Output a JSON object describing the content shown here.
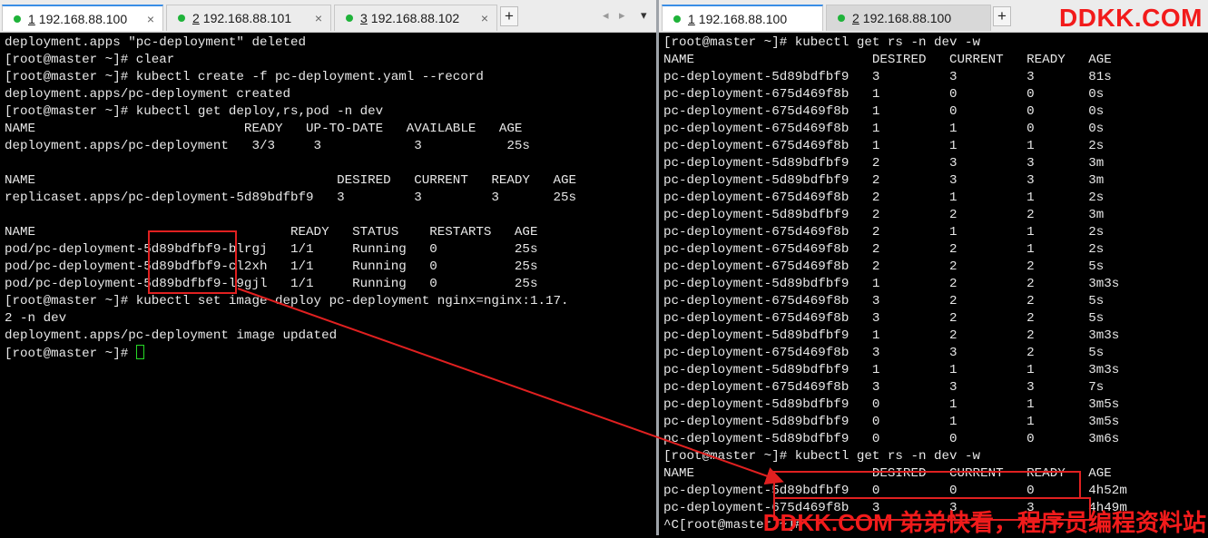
{
  "left_tabs": [
    {
      "num": "1",
      "host": "192.168.88.100"
    },
    {
      "num": "2",
      "host": "192.168.88.101"
    },
    {
      "num": "3",
      "host": "192.168.88.102"
    }
  ],
  "right_tabs": [
    {
      "num": "1",
      "host": "192.168.88.100"
    },
    {
      "num": "2",
      "host": "192.168.88.100"
    }
  ],
  "tab_close_glyph": "×",
  "add_tab_glyph": "+",
  "nav_prev_glyph": "◂",
  "nav_next_glyph": "▸",
  "tab_menu_glyph": "▾",
  "status_dot_color": "#1fb33a",
  "left_terminal": [
    "deployment.apps \"pc-deployment\" deleted",
    "[root@master ~]# clear",
    "[root@master ~]# kubectl create -f pc-deployment.yaml --record",
    "deployment.apps/pc-deployment created",
    "[root@master ~]# kubectl get deploy,rs,pod -n dev",
    "NAME                           READY   UP-TO-DATE   AVAILABLE   AGE",
    "deployment.apps/pc-deployment   3/3     3            3           25s",
    "",
    "NAME                                       DESIRED   CURRENT   READY   AGE",
    "replicaset.apps/pc-deployment-5d89bdfbf9   3         3         3       25s",
    "",
    "NAME                                 READY   STATUS    RESTARTS   AGE",
    "pod/pc-deployment-5d89bdfbf9-blrgj   1/1     Running   0          25s",
    "pod/pc-deployment-5d89bdfbf9-cl2xh   1/1     Running   0          25s",
    "pod/pc-deployment-5d89bdfbf9-l9gjl   1/1     Running   0          25s",
    "[root@master ~]# kubectl set image deploy pc-deployment nginx=nginx:1.17.",
    "2 -n dev",
    "deployment.apps/pc-deployment image updated"
  ],
  "left_prompt": "[root@master ~]# ",
  "right_terminal": [
    "[root@master ~]# kubectl get rs -n dev -w",
    "NAME                       DESIRED   CURRENT   READY   AGE",
    "pc-deployment-5d89bdfbf9   3         3         3       81s",
    "pc-deployment-675d469f8b   1         0         0       0s",
    "pc-deployment-675d469f8b   1         0         0       0s",
    "pc-deployment-675d469f8b   1         1         0       0s",
    "pc-deployment-675d469f8b   1         1         1       2s",
    "pc-deployment-5d89bdfbf9   2         3         3       3m",
    "pc-deployment-5d89bdfbf9   2         3         3       3m",
    "pc-deployment-675d469f8b   2         1         1       2s",
    "pc-deployment-5d89bdfbf9   2         2         2       3m",
    "pc-deployment-675d469f8b   2         1         1       2s",
    "pc-deployment-675d469f8b   2         2         1       2s",
    "pc-deployment-675d469f8b   2         2         2       5s",
    "pc-deployment-5d89bdfbf9   1         2         2       3m3s",
    "pc-deployment-675d469f8b   3         2         2       5s",
    "pc-deployment-675d469f8b   3         2         2       5s",
    "pc-deployment-5d89bdfbf9   1         2         2       3m3s",
    "pc-deployment-675d469f8b   3         3         2       5s",
    "pc-deployment-5d89bdfbf9   1         1         1       3m3s",
    "pc-deployment-675d469f8b   3         3         3       7s",
    "pc-deployment-5d89bdfbf9   0         1         1       3m5s",
    "pc-deployment-5d89bdfbf9   0         1         1       3m5s",
    "pc-deployment-5d89bdfbf9   0         0         0       3m6s",
    "[root@master ~]# kubectl get rs -n dev -w",
    "NAME                       DESIRED   CURRENT   READY   AGE",
    "pc-deployment-5d89bdfbf9   0         0         0       4h52m",
    "pc-deployment-675d469f8b   3         3         3       4h49m",
    "^C[root@master ~]# "
  ],
  "watermark_top": "DDKK.COM",
  "watermark_bottom": "DDKK.COM 弟弟快看，程序员编程资料站",
  "annotation_color": "#e02020"
}
